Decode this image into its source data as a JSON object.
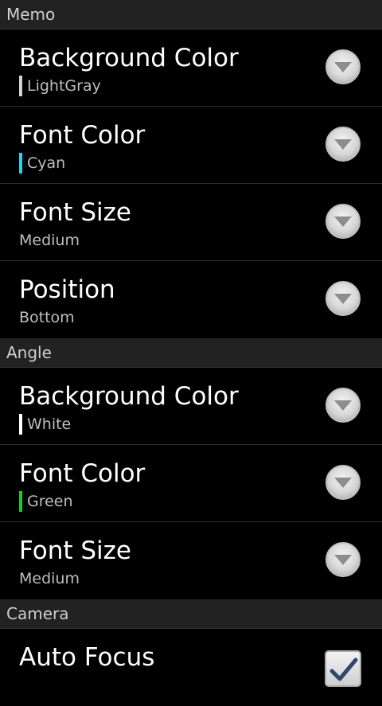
{
  "memo": {
    "header": "Memo",
    "background_color": {
      "title": "Background Color",
      "summary": "LightGray",
      "swatch": "#d3d3d3"
    },
    "font_color": {
      "title": "Font Color",
      "summary": "Cyan",
      "swatch": "#00e5ff"
    },
    "font_size": {
      "title": "Font Size",
      "summary": "Medium"
    },
    "position": {
      "title": "Position",
      "summary": "Bottom"
    }
  },
  "angle": {
    "header": "Angle",
    "background_color": {
      "title": "Background Color",
      "summary": "White",
      "swatch": "#ffffff"
    },
    "font_color": {
      "title": "Font Color",
      "summary": "Green",
      "swatch": "#00e000"
    },
    "font_size": {
      "title": "Font Size",
      "summary": "Medium"
    }
  },
  "camera": {
    "header": "Camera",
    "auto_focus": {
      "title": "Auto Focus",
      "checked": true
    }
  }
}
